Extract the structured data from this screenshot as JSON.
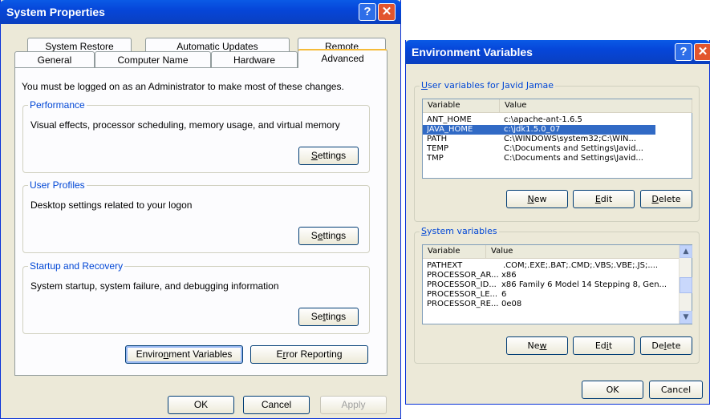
{
  "sys": {
    "title": "System Properties",
    "help": "?",
    "close": "✕",
    "tabs_row1": [
      "System Restore",
      "Automatic Updates",
      "Remote"
    ],
    "tabs_row2": [
      "General",
      "Computer Name",
      "Hardware",
      "Advanced"
    ],
    "admin_note": "You must be logged on as an Administrator to make most of these changes.",
    "perf": {
      "title": "Performance",
      "desc": "Visual effects, processor scheduling, memory usage, and virtual memory",
      "btn_u": "S",
      "btn_rest": "ettings"
    },
    "profiles": {
      "title": "User Profiles",
      "desc": "Desktop settings related to your logon",
      "btn_pre": "S",
      "btn_u": "e",
      "btn_rest": "ttings"
    },
    "startup": {
      "title": "Startup and Recovery",
      "desc": "System startup, system failure, and debugging information",
      "btn_pre": "Se",
      "btn_u": "t",
      "btn_rest": "tings"
    },
    "env_btn": {
      "pre": "Enviro",
      "u": "n",
      "rest": "ment Variables"
    },
    "err_btn": {
      "pre": "E",
      "u": "r",
      "rest": "ror Reporting"
    },
    "ok": "OK",
    "cancel": "Cancel",
    "apply": "Apply"
  },
  "env": {
    "title": "Environment Variables",
    "help": "?",
    "close": "✕",
    "user_group": {
      "pre": "",
      "u": "U",
      "rest": "ser variables for Javid Jamae"
    },
    "sys_group": {
      "pre": "",
      "u": "S",
      "rest": "ystem variables"
    },
    "columns": [
      "Variable",
      "Value"
    ],
    "user_vars": [
      {
        "name": "ANT_HOME",
        "value": "c:\\apache-ant-1.6.5"
      },
      {
        "name": "JAVA_HOME",
        "value": "c:\\jdk1.5.0_07"
      },
      {
        "name": "PATH",
        "value": "C:\\WINDOWS\\system32;C:\\WIN..."
      },
      {
        "name": "TEMP",
        "value": "C:\\Documents and Settings\\Javid..."
      },
      {
        "name": "TMP",
        "value": "C:\\Documents and Settings\\Javid..."
      }
    ],
    "sys_vars": [
      {
        "name": "PATHEXT",
        "value": ".COM;.EXE;.BAT;.CMD;.VBS;.VBE;.JS;...."
      },
      {
        "name": "PROCESSOR_AR...",
        "value": "x86"
      },
      {
        "name": "PROCESSOR_ID...",
        "value": "x86 Family 6 Model 14 Stepping 8, Gen..."
      },
      {
        "name": "PROCESSOR_LE...",
        "value": "6"
      },
      {
        "name": "PROCESSOR_RE...",
        "value": "0e08"
      }
    ],
    "user_btns": {
      "new": {
        "u": "N",
        "rest": "ew"
      },
      "edit": {
        "u": "E",
        "rest": "dit"
      },
      "delete": {
        "u": "D",
        "rest": "elete"
      }
    },
    "sys_btns": {
      "new": {
        "pre": "Ne",
        "u": "w",
        "rest": ""
      },
      "edit": {
        "pre": "Ed",
        "u": "i",
        "rest": "t"
      },
      "delete": {
        "pre": "De",
        "u": "l",
        "rest": "ete"
      }
    },
    "ok": "OK",
    "cancel": "Cancel"
  }
}
